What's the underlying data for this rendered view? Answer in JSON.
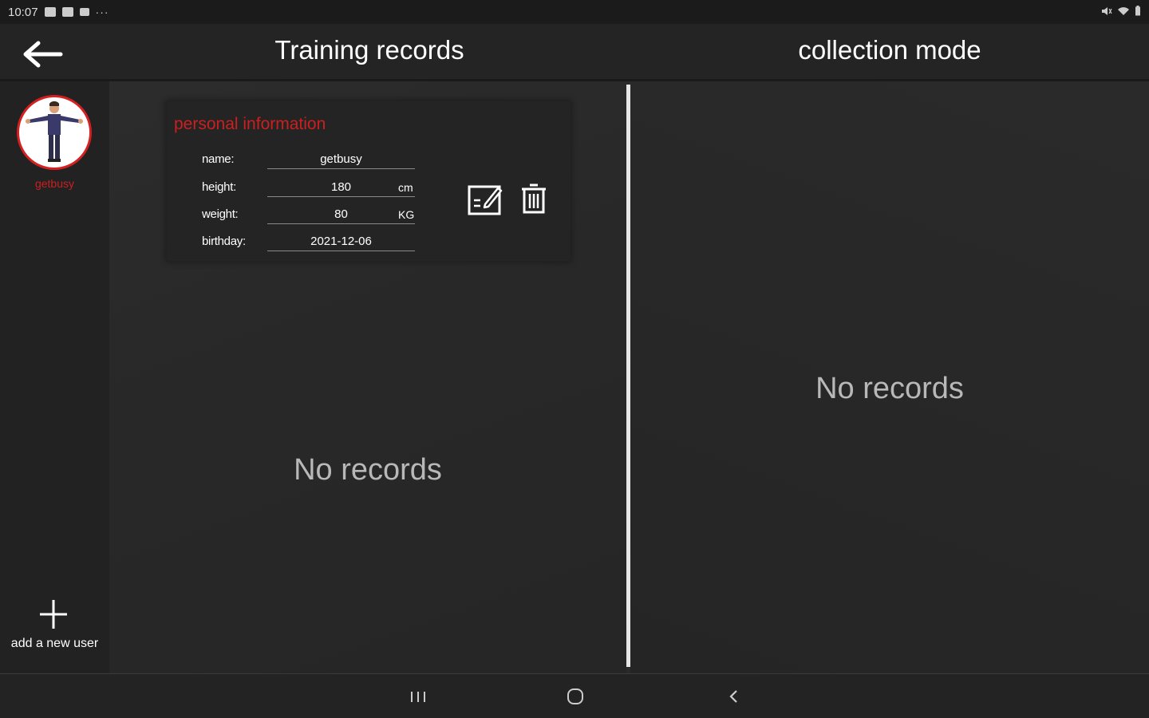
{
  "status_bar": {
    "time": "10:07",
    "more": "···"
  },
  "header": {
    "back_icon": "arrow-left-icon",
    "title_left": "Training records",
    "title_right": "collection mode"
  },
  "sidebar": {
    "user_name": "getbusy",
    "add_user_label": "add a new user"
  },
  "personal_info": {
    "title": "personal information",
    "fields": [
      {
        "label": "name:",
        "value": "getbusy",
        "unit": ""
      },
      {
        "label": "height:",
        "value": "180",
        "unit": "cm"
      },
      {
        "label": "weight:",
        "value": "80",
        "unit": "KG"
      },
      {
        "label": "birthday:",
        "value": "2021-12-06",
        "unit": ""
      }
    ]
  },
  "training_records": {
    "empty_text": "No records"
  },
  "collection_mode": {
    "empty_text": "No records"
  },
  "colors": {
    "accent": "#cc1f1f",
    "background": "#2a2a2a",
    "divider": "#e6e6e6"
  }
}
